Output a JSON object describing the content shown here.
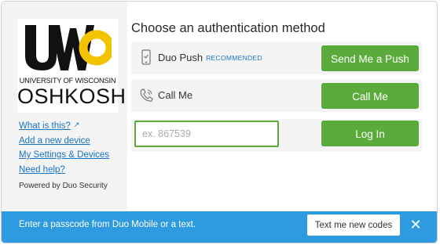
{
  "logo": {
    "letters": "UWO",
    "university_line": "UNIVERSITY OF WISCONSIN",
    "campus": "OSHKOSH",
    "colors": {
      "primary": "#111111",
      "accent": "#f4c300"
    }
  },
  "sidebar": {
    "links": [
      {
        "label": "What is this?",
        "icon": "external-link-icon"
      },
      {
        "label": "Add a new device"
      },
      {
        "label": "My Settings & Devices"
      },
      {
        "label": "Need help?"
      }
    ],
    "powered_by": "Powered by Duo Security"
  },
  "main": {
    "title": "Choose an authentication method",
    "methods": [
      {
        "label": "Duo Push",
        "badge": "RECOMMENDED",
        "icon": "phone-icon",
        "button": "Send Me a Push"
      },
      {
        "label": "Call Me",
        "icon": "phone-call-icon",
        "button": "Call Me"
      }
    ],
    "passcode": {
      "placeholder": "ex. 867539",
      "value": "",
      "button": "Log In"
    }
  },
  "notification": {
    "message": "Enter a passcode from Duo Mobile or a text.",
    "button": "Text me new codes",
    "close_icon": "close-icon"
  },
  "colors": {
    "accent_green": "#5aab3c",
    "link_blue": "#1773c6",
    "bar_blue": "#2e9be0",
    "panel_gray": "#f4f4f4"
  }
}
